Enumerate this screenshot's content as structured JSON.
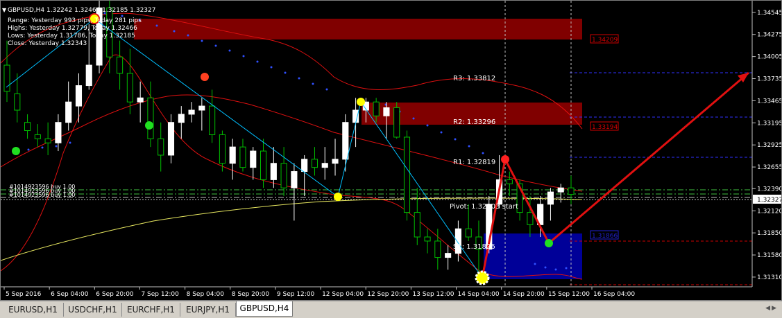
{
  "header": {
    "symbol_line": "GBPUSD,H4  1.32242 1.32466 1.32185 1.32327",
    "range_line": "Range: Yesterday 993 pips, Today 281 pips",
    "highs_line": "Highs: Yesterday 1.32779, Today 1.32466",
    "lows_line": "Lows:  Yesterday 1.31786, Today 1.32185",
    "close_line": "Close: Yesterday 1.32343"
  },
  "price_axis": {
    "ticks": [
      "1.34545",
      "1.34275",
      "1.34005",
      "1.33735",
      "1.33465",
      "1.33195",
      "1.32925",
      "1.32655",
      "1.32390",
      "1.32120",
      "1.31850",
      "1.31580",
      "1.31310"
    ],
    "current_price": "1.32327"
  },
  "time_axis": {
    "labels": [
      "5 Sep 2016",
      "6 Sep 04:00",
      "6 Sep 20:00",
      "7 Sep 12:00",
      "8 Sep 04:00",
      "8 Sep 20:00",
      "9 Sep 12:00",
      "12 Sep 04:00",
      "12 Sep 20:00",
      "13 Sep 12:00",
      "14 Sep 04:00",
      "14 Sep 20:00",
      "15 Sep 12:00",
      "16 Sep 04:00"
    ]
  },
  "levels": {
    "r3": "R3: 1.33812",
    "r2": "R2: 1.33296",
    "r1": "R1: 1.32819",
    "pivot": "Pivot: 1.32303 start",
    "s1": "S1: 1.31826",
    "zone_top_label": "1.34209",
    "zone_mid_label": "1.33194",
    "zone_low_label": "1.31866"
  },
  "order_labels": {
    "line1": "#1014923596 buy 1.00",
    "line2": "#1014923596 buy 1.00",
    "line3": "#1014923596 buy 1.00"
  },
  "tabs": [
    {
      "label": "EURUSD,H1",
      "active": false
    },
    {
      "label": "USDCHF,H1",
      "active": false
    },
    {
      "label": "EURCHF,H1",
      "active": false
    },
    {
      "label": "EURJPY,H1",
      "active": false
    },
    {
      "label": "GBPUSD,H4",
      "active": true
    }
  ],
  "colors": {
    "bull": "#ffffff",
    "bear_wick": "#00c000",
    "zigzag": "#00bfff",
    "arrow": "#e01010",
    "supply_zone": "#8b0000",
    "demand_zone": "#0000a0"
  },
  "chart_data": {
    "type": "candlestick",
    "symbol": "GBPUSD",
    "timeframe": "H4",
    "ylim": [
      1.3125,
      1.3462
    ],
    "open": 1.32242,
    "high": 1.32466,
    "low": 1.32185,
    "close": 1.32327,
    "pivot_levels": {
      "R3": 1.33812,
      "R2": 1.33296,
      "R1": 1.32819,
      "Pivot": 1.32303,
      "S1": 1.31826
    },
    "candles": [
      [
        1.339,
        1.342,
        1.3345,
        1.3358
      ],
      [
        1.3355,
        1.338,
        1.332,
        1.3335
      ],
      [
        1.332,
        1.333,
        1.33,
        1.331
      ],
      [
        1.3305,
        1.3318,
        1.329,
        1.33
      ],
      [
        1.33,
        1.332,
        1.328,
        1.3295
      ],
      [
        1.3295,
        1.333,
        1.3285,
        1.332
      ],
      [
        1.332,
        1.337,
        1.331,
        1.3345
      ],
      [
        1.334,
        1.338,
        1.332,
        1.3365
      ],
      [
        1.3365,
        1.344,
        1.336,
        1.339
      ],
      [
        1.339,
        1.353,
        1.338,
        1.346
      ],
      [
        1.346,
        1.348,
        1.338,
        1.34
      ],
      [
        1.34,
        1.342,
        1.336,
        1.338
      ],
      [
        1.338,
        1.341,
        1.333,
        1.3345
      ],
      [
        1.3345,
        1.337,
        1.332,
        1.335
      ],
      [
        1.335,
        1.337,
        1.329,
        1.33
      ],
      [
        1.33,
        1.332,
        1.326,
        1.328
      ],
      [
        1.328,
        1.333,
        1.327,
        1.332
      ],
      [
        1.332,
        1.334,
        1.33,
        1.333
      ],
      [
        1.333,
        1.3345,
        1.332,
        1.3335
      ],
      [
        1.3335,
        1.335,
        1.331,
        1.334
      ],
      [
        1.334,
        1.336,
        1.3295,
        1.3305
      ],
      [
        1.3305,
        1.331,
        1.326,
        1.327
      ],
      [
        1.327,
        1.33,
        1.325,
        1.329
      ],
      [
        1.329,
        1.33,
        1.326,
        1.3265
      ],
      [
        1.3265,
        1.329,
        1.325,
        1.3285
      ],
      [
        1.3285,
        1.33,
        1.324,
        1.325
      ],
      [
        1.325,
        1.329,
        1.324,
        1.327
      ],
      [
        1.327,
        1.329,
        1.323,
        1.324
      ],
      [
        1.324,
        1.327,
        1.32,
        1.326
      ],
      [
        1.326,
        1.328,
        1.323,
        1.3275
      ],
      [
        1.3275,
        1.329,
        1.3255,
        1.3265
      ],
      [
        1.3265,
        1.329,
        1.325,
        1.327
      ],
      [
        1.327,
        1.33,
        1.3255,
        1.3275
      ],
      [
        1.3275,
        1.333,
        1.326,
        1.332
      ],
      [
        1.332,
        1.335,
        1.329,
        1.3335
      ],
      [
        1.3335,
        1.335,
        1.332,
        1.3345
      ],
      [
        1.3345,
        1.335,
        1.332,
        1.3328
      ],
      [
        1.3328,
        1.3345,
        1.33,
        1.3338
      ],
      [
        1.3338,
        1.3345,
        1.33,
        1.3302
      ],
      [
        1.3302,
        1.331,
        1.32,
        1.321
      ],
      [
        1.321,
        1.324,
        1.317,
        1.318
      ],
      [
        1.318,
        1.319,
        1.316,
        1.3175
      ],
      [
        1.3175,
        1.319,
        1.314,
        1.3155
      ],
      [
        1.3155,
        1.317,
        1.314,
        1.316
      ],
      [
        1.316,
        1.32,
        1.315,
        1.319
      ],
      [
        1.319,
        1.322,
        1.3175,
        1.318
      ],
      [
        1.318,
        1.32,
        1.3135,
        1.3165
      ],
      [
        1.3165,
        1.323,
        1.316,
        1.322
      ],
      [
        1.322,
        1.328,
        1.3215,
        1.325
      ],
      [
        1.325,
        1.326,
        1.323,
        1.3245
      ],
      [
        1.3245,
        1.325,
        1.32,
        1.321
      ],
      [
        1.321,
        1.323,
        1.318,
        1.3195
      ],
      [
        1.3195,
        1.323,
        1.318,
        1.322
      ],
      [
        1.322,
        1.324,
        1.32,
        1.3235
      ],
      [
        1.3235,
        1.3245,
        1.3222,
        1.324
      ],
      [
        1.324,
        1.3255,
        1.322,
        1.3232
      ]
    ]
  }
}
